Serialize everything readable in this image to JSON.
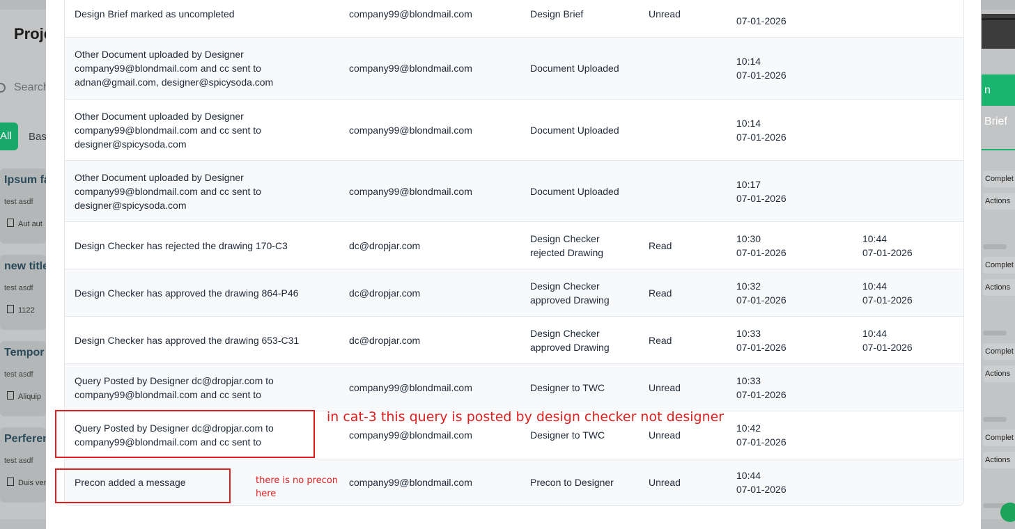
{
  "background": {
    "page_title": "Proje",
    "search_placeholder": "Search",
    "tabs": [
      {
        "label": "All"
      },
      {
        "label": "Bas"
      }
    ],
    "cards": [
      {
        "title": "Ipsum fa",
        "subtitle": "test asdf",
        "doc": "Aut aut"
      },
      {
        "title": "new title",
        "subtitle": "test asdf",
        "doc": "1122"
      },
      {
        "title": "Tempor",
        "subtitle": "test asdf",
        "doc": "Aliquip"
      },
      {
        "title": "Perferen",
        "subtitle": "test asdf",
        "doc": "Duis ver"
      }
    ],
    "right_button": "n Brief",
    "right_actions": [
      {
        "status": "Complet",
        "actions": "Actions"
      },
      {
        "status": "Complet",
        "actions": "Actions"
      },
      {
        "status": "Complet",
        "actions": "Actions"
      },
      {
        "status": "Complet",
        "actions": "Actions"
      }
    ]
  },
  "notifications": [
    {
      "message": "Design Brief marked as uncompleted",
      "email": "company99@blondmail.com",
      "type": "Design Brief",
      "status": "Unread",
      "sent_time": "",
      "sent_date": "07-01-2026",
      "read_time": "",
      "read_date": ""
    },
    {
      "message": "Other Document uploaded by Designer company99@blondmail.com and cc sent to adnan@gmail.com, designer@spicysoda.com",
      "email": "company99@blondmail.com",
      "type": "Document Uploaded",
      "status": "",
      "sent_time": "10:14",
      "sent_date": "07-01-2026",
      "read_time": "",
      "read_date": ""
    },
    {
      "message": "Other Document uploaded by Designer company99@blondmail.com and cc sent to designer@spicysoda.com",
      "email": "company99@blondmail.com",
      "type": "Document Uploaded",
      "status": "",
      "sent_time": "10:14",
      "sent_date": "07-01-2026",
      "read_time": "",
      "read_date": ""
    },
    {
      "message": "Other Document uploaded by Designer company99@blondmail.com and cc sent to designer@spicysoda.com",
      "email": "company99@blondmail.com",
      "type": "Document Uploaded",
      "status": "",
      "sent_time": "10:17",
      "sent_date": "07-01-2026",
      "read_time": "",
      "read_date": ""
    },
    {
      "message": "Design Checker has rejected the drawing 170-C3",
      "email": "dc@dropjar.com",
      "type": "Design Checker rejected Drawing",
      "status": "Read",
      "sent_time": "10:30",
      "sent_date": "07-01-2026",
      "read_time": "10:44",
      "read_date": "07-01-2026"
    },
    {
      "message": "Design Checker has approved the drawing 864-P46",
      "email": "dc@dropjar.com",
      "type": "Design Checker approved Drawing",
      "status": "Read",
      "sent_time": "10:32",
      "sent_date": "07-01-2026",
      "read_time": "10:44",
      "read_date": "07-01-2026"
    },
    {
      "message": "Design Checker has approved the drawing 653-C31",
      "email": "dc@dropjar.com",
      "type": "Design Checker approved Drawing",
      "status": "Read",
      "sent_time": "10:33",
      "sent_date": "07-01-2026",
      "read_time": "10:44",
      "read_date": "07-01-2026"
    },
    {
      "message": "Query Posted by Designer dc@dropjar.com to company99@blondmail.com and cc sent to",
      "email": "company99@blondmail.com",
      "type": "Designer to TWC",
      "status": "Unread",
      "sent_time": "10:33",
      "sent_date": "07-01-2026",
      "read_time": "",
      "read_date": ""
    },
    {
      "message": "Query Posted by Designer dc@dropjar.com to company99@blondmail.com and cc sent to",
      "email": "company99@blondmail.com",
      "type": "Designer to TWC",
      "status": "Unread",
      "sent_time": "10:42",
      "sent_date": "07-01-2026",
      "read_time": "",
      "read_date": ""
    },
    {
      "message": "Precon added a message",
      "email": "company99@blondmail.com",
      "type": "Precon to Designer",
      "status": "Unread",
      "sent_time": "10:44",
      "sent_date": "07-01-2026",
      "read_time": "",
      "read_date": ""
    }
  ],
  "annotations": {
    "cat3_note": "in cat-3 this query is posted by design checker not designer",
    "precon_note_line1": "there is no precon",
    "precon_note_line2": "here"
  },
  "colors": {
    "annotation": "#e01e1e",
    "accent_green": "#19b46f",
    "row_alt": "#f8f9fb"
  }
}
